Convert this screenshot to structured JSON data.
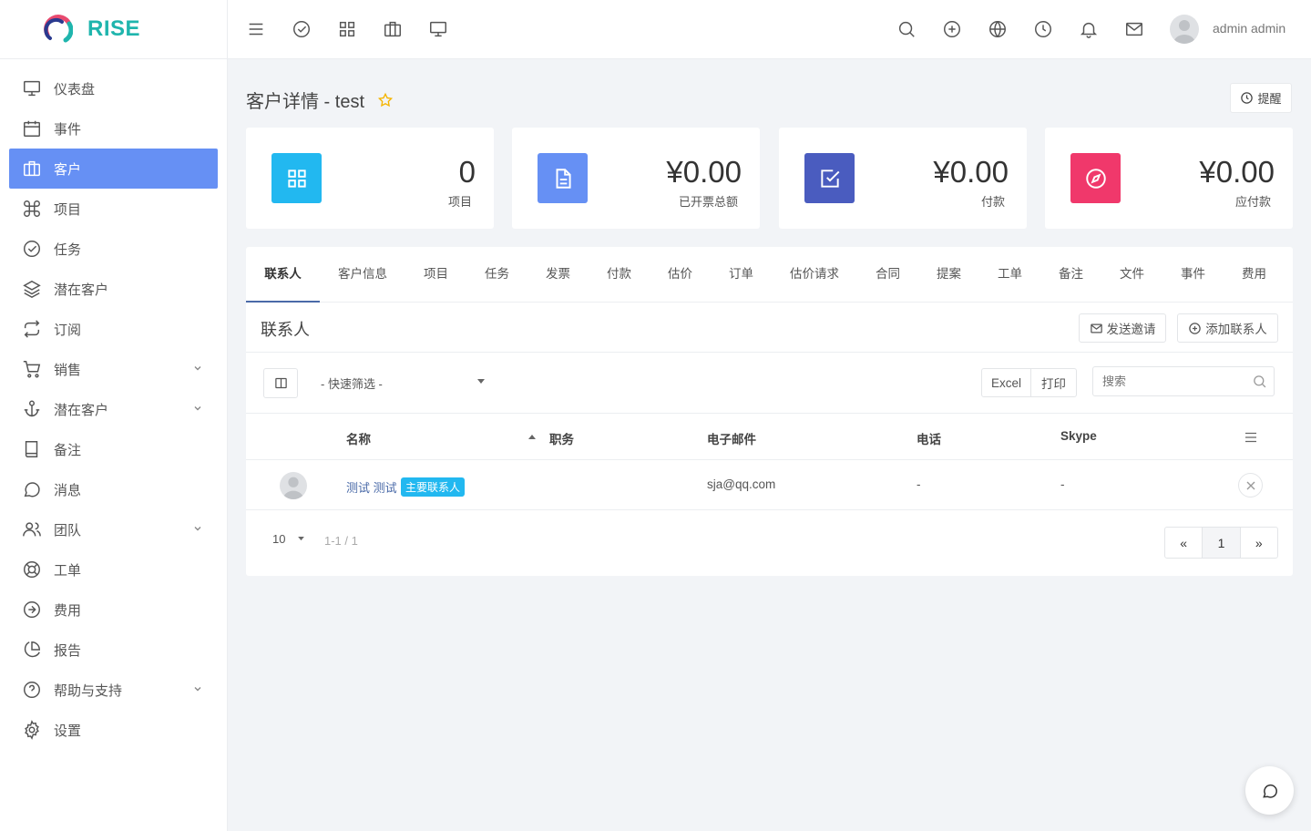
{
  "brand": {
    "name": "RISE"
  },
  "sidebar": {
    "items": [
      {
        "label": "仪表盘",
        "icon": "monitor-icon"
      },
      {
        "label": "事件",
        "icon": "calendar-icon"
      },
      {
        "label": "客户",
        "icon": "briefcase-icon",
        "active": true
      },
      {
        "label": "项目",
        "icon": "command-icon"
      },
      {
        "label": "任务",
        "icon": "check-circle-icon"
      },
      {
        "label": "潜在客户",
        "icon": "layers-icon"
      },
      {
        "label": "订阅",
        "icon": "repeat-icon"
      },
      {
        "label": "销售",
        "icon": "cart-icon",
        "expandable": true
      },
      {
        "label": "潜在客户",
        "icon": "anchor-icon",
        "expandable": true
      },
      {
        "label": "备注",
        "icon": "book-icon"
      },
      {
        "label": "消息",
        "icon": "message-icon"
      },
      {
        "label": "团队",
        "icon": "users-icon",
        "expandable": true
      },
      {
        "label": "工单",
        "icon": "lifebuoy-icon"
      },
      {
        "label": "费用",
        "icon": "arrow-circle-icon"
      },
      {
        "label": "报告",
        "icon": "pie-chart-icon"
      },
      {
        "label": "帮助与支持",
        "icon": "help-circle-icon",
        "expandable": true
      },
      {
        "label": "设置",
        "icon": "gear-icon"
      }
    ]
  },
  "topbar": {
    "user_name": "admin admin"
  },
  "page": {
    "title": "客户详情 - test",
    "remind_label": "提醒"
  },
  "stats": [
    {
      "value": "0",
      "label": "项目",
      "color": "#22b8f0"
    },
    {
      "value": "¥0.00",
      "label": "已开票总额",
      "color": "#6690f4"
    },
    {
      "value": "¥0.00",
      "label": "付款",
      "color": "#4a5cbf"
    },
    {
      "value": "¥0.00",
      "label": "应付款",
      "color": "#f0386b"
    }
  ],
  "tabs": [
    "联系人",
    "客户信息",
    "项目",
    "任务",
    "发票",
    "付款",
    "估价",
    "订单",
    "估价请求",
    "合同",
    "提案",
    "工单",
    "备注",
    "文件",
    "事件",
    "费用"
  ],
  "contacts": {
    "title": "联系人",
    "send_invite": "发送邀请",
    "add_contact": "添加联系人",
    "quick_filter": "- 快速筛选 -",
    "excel": "Excel",
    "print": "打印",
    "search_placeholder": "搜索",
    "columns": {
      "name": "名称",
      "job": "职务",
      "email": "电子邮件",
      "phone": "电话",
      "skype": "Skype"
    },
    "rows": [
      {
        "name": "测试 测试",
        "badge": "主要联系人",
        "job": "",
        "email": "sja@qq.com",
        "phone": "-",
        "skype": "-"
      }
    ],
    "page_size": "10",
    "range": "1-1 / 1",
    "prev": "«",
    "page": "1",
    "next": "»"
  },
  "colors": {
    "accent": "#6690f4",
    "brand": "#1fb5ad"
  }
}
